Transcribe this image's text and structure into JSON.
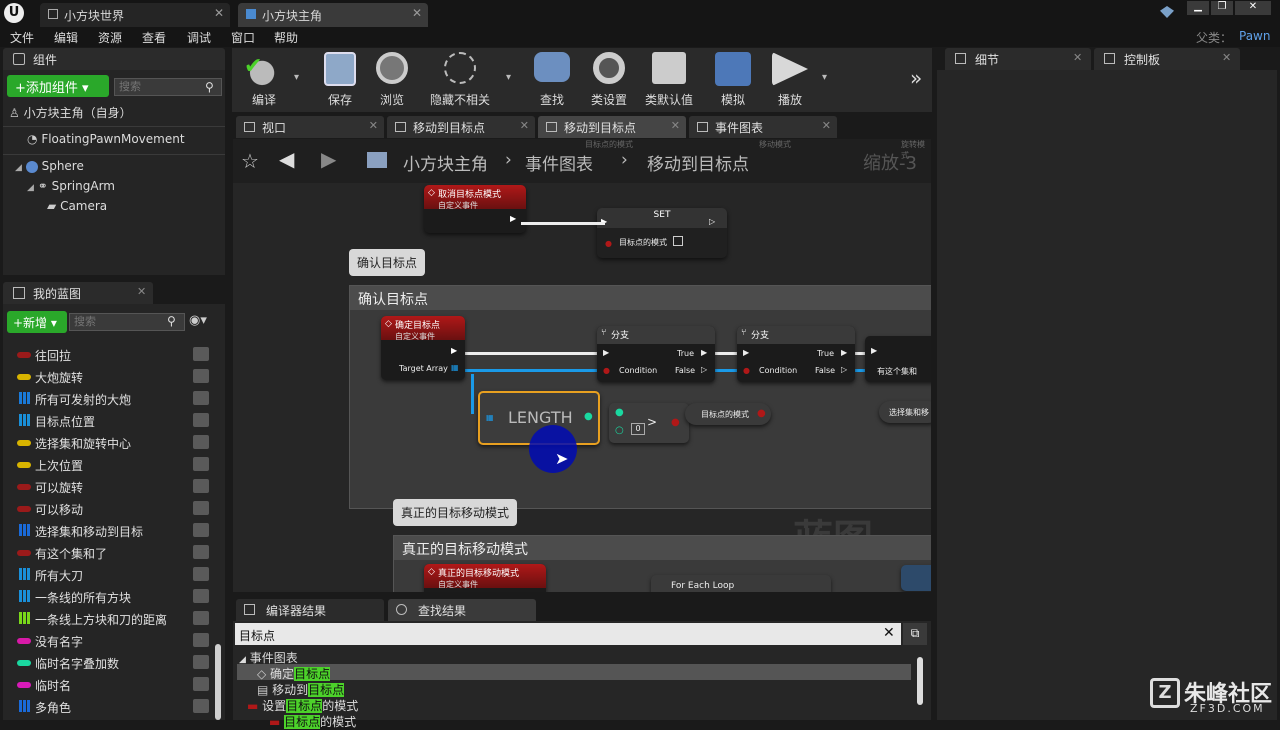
{
  "title_bar": {
    "tabs": [
      {
        "label": "小方块世界"
      },
      {
        "label": "小方块主角"
      }
    ],
    "user_label": "父类：",
    "user_value": "Pawn"
  },
  "menu": [
    "文件",
    "编辑",
    "资源",
    "查看",
    "调试",
    "窗口",
    "帮助"
  ],
  "components_panel": {
    "title": "组件",
    "add_button": "+添加组件",
    "search_placeholder": "搜索",
    "root": "小方块主角（自身）",
    "items": [
      "FloatingPawnMovement",
      "Sphere",
      "SpringArm",
      "Camera"
    ]
  },
  "my_blueprint_panel": {
    "title": "我的蓝图",
    "new_button": "+新增",
    "search_placeholder": "搜索",
    "variables": [
      {
        "label": "往回拉",
        "color": "#9a1a1a",
        "kind": "pill"
      },
      {
        "label": "大炮旋转",
        "color": "#d8b400",
        "kind": "pill"
      },
      {
        "label": "所有可发射的大炮",
        "color": "#1a7ad8",
        "kind": "grid"
      },
      {
        "label": "目标点位置",
        "color": "#1a8fd8",
        "kind": "grid"
      },
      {
        "label": "选择集和旋转中心",
        "color": "#d8b400",
        "kind": "pill"
      },
      {
        "label": "上次位置",
        "color": "#d8b400",
        "kind": "pill"
      },
      {
        "label": "可以旋转",
        "color": "#9a1a1a",
        "kind": "pill"
      },
      {
        "label": "可以移动",
        "color": "#9a1a1a",
        "kind": "pill"
      },
      {
        "label": "选择集和移动到目标",
        "color": "#1a6ad8",
        "kind": "grid"
      },
      {
        "label": "有这个集和了",
        "color": "#9a1a1a",
        "kind": "pill"
      },
      {
        "label": "所有大刀",
        "color": "#1a8fd8",
        "kind": "grid"
      },
      {
        "label": "一条线的所有方块",
        "color": "#1a8fd8",
        "kind": "grid"
      },
      {
        "label": "一条线上方块和刀的距离",
        "color": "#7ad81a",
        "kind": "grid"
      },
      {
        "label": "没有名字",
        "color": "#d81aa8",
        "kind": "pill"
      },
      {
        "label": "临时名字叠加数",
        "color": "#1ad8a0",
        "kind": "pill"
      },
      {
        "label": "临时名",
        "color": "#d81ab8",
        "kind": "pill"
      },
      {
        "label": "多角色",
        "color": "#1a6ad8",
        "kind": "grid"
      }
    ]
  },
  "toolbar": {
    "buttons": [
      "编译",
      "保存",
      "浏览",
      "隐藏不相关",
      "查找",
      "类设置",
      "类默认值",
      "模拟",
      "播放"
    ]
  },
  "editor_tabs": [
    "视口",
    "移动到目标点",
    "移动到目标点",
    "事件图表"
  ],
  "breadcrumb": {
    "parts": [
      "小方块主角",
      "事件图表",
      "移动到目标点"
    ],
    "zoom": "缩放-3"
  },
  "graph": {
    "top_node": {
      "title": "取消目标点模式",
      "subtitle": "自定义事件"
    },
    "set_node": {
      "title": "SET",
      "pin": "目标点的模式"
    },
    "comment1_bubble": "确认目标点",
    "comment1_title": "确认目标点",
    "confirm_node": {
      "title": "确定目标点",
      "subtitle": "自定义事件",
      "pin": "Target Array"
    },
    "branch1": {
      "title": "分支",
      "true": "True",
      "false": "False",
      "cond": "Condition"
    },
    "branch2": {
      "title": "分支",
      "true": "True",
      "false": "False",
      "cond": "Condition"
    },
    "length_node": "LENGTH",
    "compare_value": "0",
    "mode_var": "目标点的模式",
    "cut_node1": "有这个集和",
    "cut_node2": "选择集和移",
    "comment2_bubble": "真正的目标移动模式",
    "comment2_title": "真正的目标移动模式",
    "bottom_event": {
      "title": "真正的目标移动模式",
      "subtitle": "自定义事件"
    },
    "foreach": "For Each Loop",
    "watermark": "蓝图",
    "ghost_labels": [
      "目标点的模式",
      "移动模式",
      "旋转模式"
    ]
  },
  "right_panel": {
    "tab1": "细节",
    "tab2": "控制板"
  },
  "bottom_panel": {
    "tabs": [
      "编译器结果",
      "查找结果"
    ],
    "search_value": "目标点",
    "results_root": "事件图表",
    "results": [
      {
        "pre": "确定",
        "hit": "目标点",
        "post": ""
      },
      {
        "pre": "移动到",
        "hit": "目标点",
        "post": ""
      },
      {
        "pre": "设置",
        "hit": "目标点",
        "post": "的模式"
      },
      {
        "pre": "",
        "hit": "目标点",
        "post": "的模式"
      }
    ]
  },
  "brand": {
    "name": "朱峰社区",
    "url": "ZF3D.COM"
  }
}
